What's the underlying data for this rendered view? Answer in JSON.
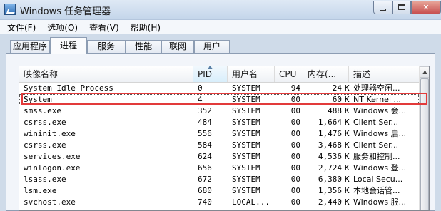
{
  "window": {
    "title": "Windows 任务管理器",
    "controls": {
      "minimize": "",
      "maximize": "",
      "close": "✕"
    }
  },
  "menu": [
    "文件(F)",
    "选项(O)",
    "查看(V)",
    "帮助(H)"
  ],
  "tabs": [
    "应用程序",
    "进程",
    "服务",
    "性能",
    "联网",
    "用户"
  ],
  "active_tab": "进程",
  "columns": [
    "映像名称",
    "PID",
    "用户名",
    "CPU",
    "内存(...",
    "描述"
  ],
  "sorted_column": "PID",
  "processes": [
    [
      "System Idle Process",
      "0",
      "SYSTEM",
      "94",
      "24",
      "K",
      "处理器空闲..."
    ],
    [
      "System",
      "4",
      "SYSTEM",
      "00",
      "60",
      "K",
      "NT Kernel ..."
    ],
    [
      "smss.exe",
      "352",
      "SYSTEM",
      "00",
      "488",
      "K",
      "Windows 会..."
    ],
    [
      "csrss.exe",
      "484",
      "SYSTEM",
      "00",
      "1,664",
      "K",
      "Client Ser..."
    ],
    [
      "wininit.exe",
      "556",
      "SYSTEM",
      "00",
      "1,476",
      "K",
      "Windows 启..."
    ],
    [
      "csrss.exe",
      "584",
      "SYSTEM",
      "00",
      "3,468",
      "K",
      "Client Ser..."
    ],
    [
      "services.exe",
      "624",
      "SYSTEM",
      "00",
      "4,536",
      "K",
      "服务和控制..."
    ],
    [
      "winlogon.exe",
      "656",
      "SYSTEM",
      "00",
      "2,724",
      "K",
      "Windows 登..."
    ],
    [
      "lsass.exe",
      "672",
      "SYSTEM",
      "00",
      "6,380",
      "K",
      "Local Secu..."
    ],
    [
      "lsm.exe",
      "680",
      "SYSTEM",
      "00",
      "1,356",
      "K",
      "本地会话管..."
    ],
    [
      "svchost.exe",
      "740",
      "LOCAL...",
      "00",
      "2,440",
      "K",
      "Windows 服..."
    ]
  ],
  "highlighted_process": "System",
  "colors": {
    "highlight": "#e23a3a",
    "titlebar": "#c4d5ea"
  },
  "icons": {
    "app": "task-manager-icon",
    "sort": "sort-ascending-icon"
  }
}
